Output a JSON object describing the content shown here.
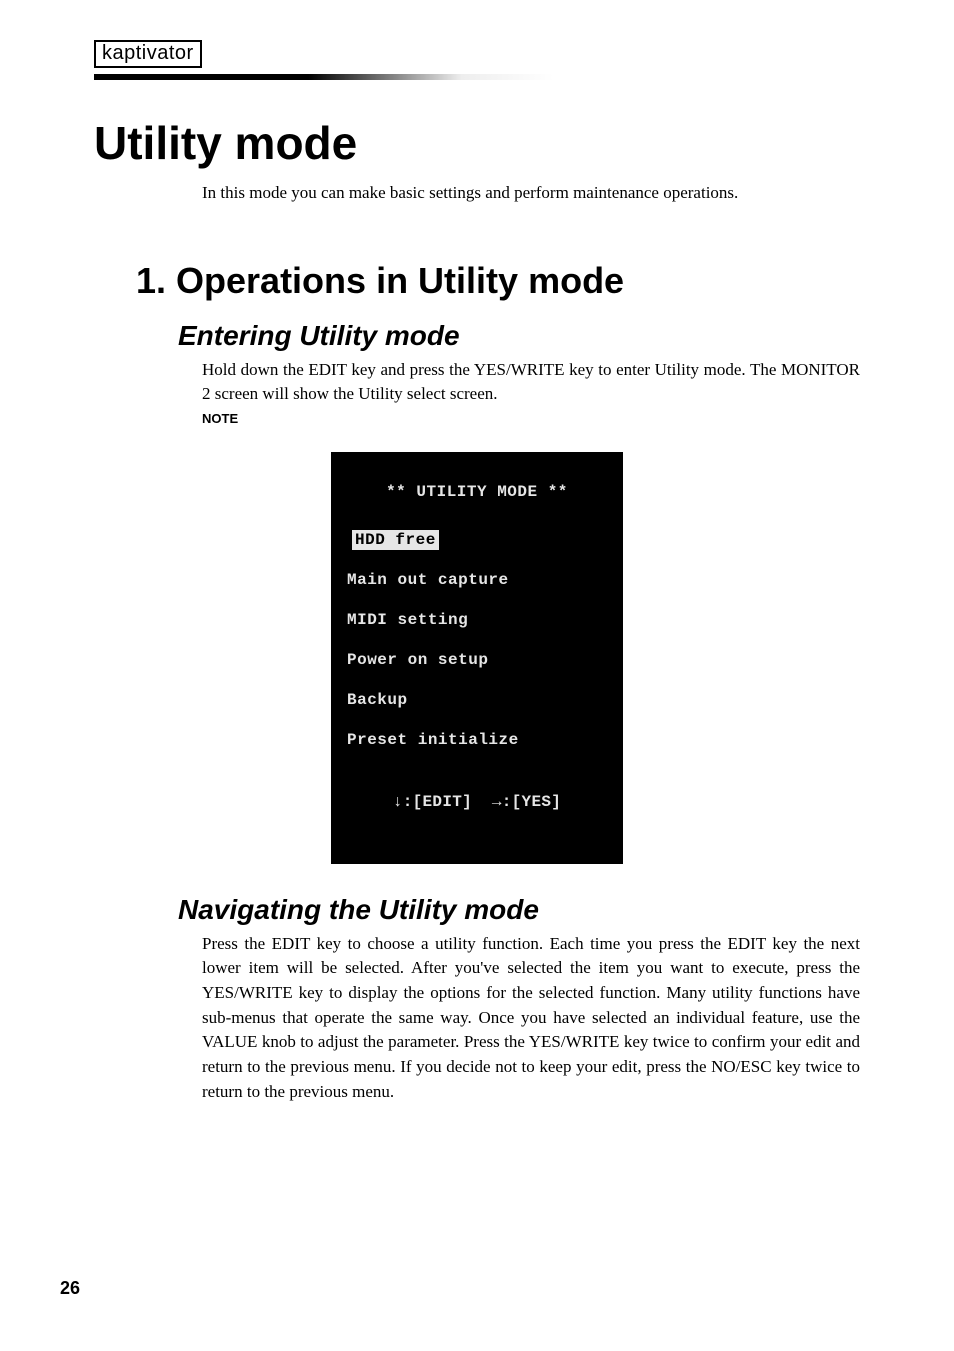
{
  "brand": "kaptivator",
  "h1": "Utility mode",
  "intro": "In this mode you can make basic settings and perform maintenance operations.",
  "h2": "1.  Operations in Utility mode",
  "section1": {
    "h3": "Entering Utility mode",
    "p": "Hold down the EDIT key and press the YES/WRITE key to enter Utility mode. The MONITOR 2 screen will show the Utility select screen.",
    "note": "NOTE"
  },
  "lcd": {
    "title": "** UTILITY MODE **",
    "selected": "HDD free",
    "items": [
      "Main out capture",
      "MIDI setting",
      "Power on setup",
      "Backup",
      "Preset initialize"
    ],
    "footer": "↓:[EDIT]  →:[YES]"
  },
  "section2": {
    "h3": "Navigating the Utility mode",
    "p": "Press the EDIT key to choose a utility function. Each time you press the EDIT key the next lower item will be selected. After you've selected the item you want to execute, press the YES/WRITE key to display the options for the selected function. Many utility functions have sub-menus that operate the same way. Once you have selected an individual feature, use the VALUE knob to adjust the parameter. Press the YES/WRITE key twice to confirm your edit and return to the previous  menu. If you decide not to keep your edit, press the NO/ESC key twice to return to the previous menu."
  },
  "pageNumber": "26"
}
